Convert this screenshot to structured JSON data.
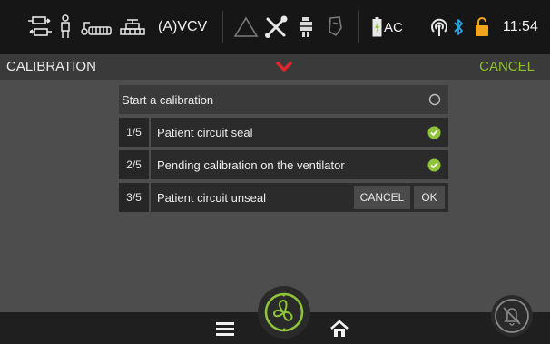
{
  "status_bar": {
    "icons": [
      "ventilation-mode-icon",
      "patient-adult-icon",
      "circuit-icon",
      "exhalation-valve-icon",
      "alarm-triangle-icon",
      "tools-icon",
      "humidifier-icon",
      "mask-icon",
      "battery-charging-icon",
      "wifi-icon",
      "bluetooth-icon",
      "unlocked-padlock-icon"
    ],
    "mode": "(A)VCV",
    "power_source": "AC",
    "time": "11:54"
  },
  "title_bar": {
    "title": "CALIBRATION",
    "cancel_label": "CANCEL"
  },
  "calibration": {
    "header": "Start a calibration",
    "steps": [
      {
        "number": "1/5",
        "label": "Patient circuit seal",
        "status": "complete"
      },
      {
        "number": "2/5",
        "label": "Pending calibration on the ventilator",
        "status": "complete"
      },
      {
        "number": "3/5",
        "label": "Patient circuit unseal",
        "status": "pending"
      }
    ],
    "cancel_label": "CANCEL",
    "ok_label": "OK"
  },
  "bottom_bar": {
    "icons": [
      "menu-icon",
      "ventilation-start-icon",
      "home-icon",
      "alarm-silence-icon"
    ]
  },
  "colors": {
    "accent": "#8fbe2f",
    "check": "#8fc43a",
    "chevron": "#e0262c",
    "bluetooth": "#2ea3e3",
    "lock": "#f2a51a"
  }
}
